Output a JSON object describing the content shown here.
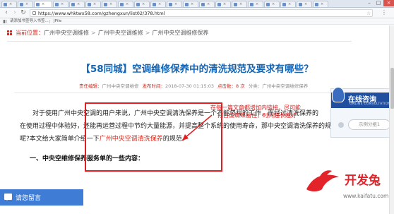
{
  "browser": {
    "tab_count": 20,
    "url": "https://www.whktwx58.com/gzhengxun/list02/378.html",
    "bookmarks": {
      "apps_label": "应用",
      "import_hint": "请添加书签导入书签...",
      "current_page": "JPile"
    }
  },
  "breadcrumb": {
    "current_label": "当前位置：",
    "items": [
      "广州中央空调维修",
      "广州中央空调维修",
      "广州中央空调维修保养"
    ],
    "separator": ">"
  },
  "article": {
    "title": "【58同城】空调维修保养中的清洗规范及要求有哪些？",
    "meta": {
      "author_key": "责任编辑：",
      "author": "广州中央空调维修",
      "published_key": "发布时间：",
      "published": "2018-07-30 01:15:03",
      "clicks_key": "点击数：",
      "clicks": "8 次",
      "category_key": "分类：",
      "category": "广州中央空调维修保养"
    },
    "paragraph": {
      "line1": "对于使用广州中央空调的用户来说，广州中央空调清洗保养是一个不能忽视的工作，而经过清洗保养的",
      "line2": "在使用过程中体验好，还能再运营过程中节约大量能源，并提高整个系统的使用寿命，那中央空调清洗保养的规范是哪些",
      "line3_prefix": "呢?本文给大家简单介绍一下",
      "line3_link": "广州中央空调清洗保养",
      "line3_suffix": "的规范。"
    },
    "section_heading": "一、中央空维修保养服务单的一些内容："
  },
  "annotation": {
    "note_line1": "在每一篇文章都增加内链接，尽可能",
    "note_line2": "把百度蜘蛛留住，时间越长越好"
  },
  "consult": {
    "title": "在线咨询",
    "subtitle": "ONLINE CONSULTATION",
    "button_label": "示例分组1"
  },
  "message_bar": {
    "label": "请您留言"
  },
  "watermark": {
    "text": "开发兔",
    "url": "www.kaifatu.com"
  },
  "colors": {
    "accent_red": "#d8291c",
    "title_blue": "#1464b4",
    "annotation_red": "#e02020",
    "consult_navy": "#1f4f9e",
    "message_blue": "#3e7cd6"
  }
}
